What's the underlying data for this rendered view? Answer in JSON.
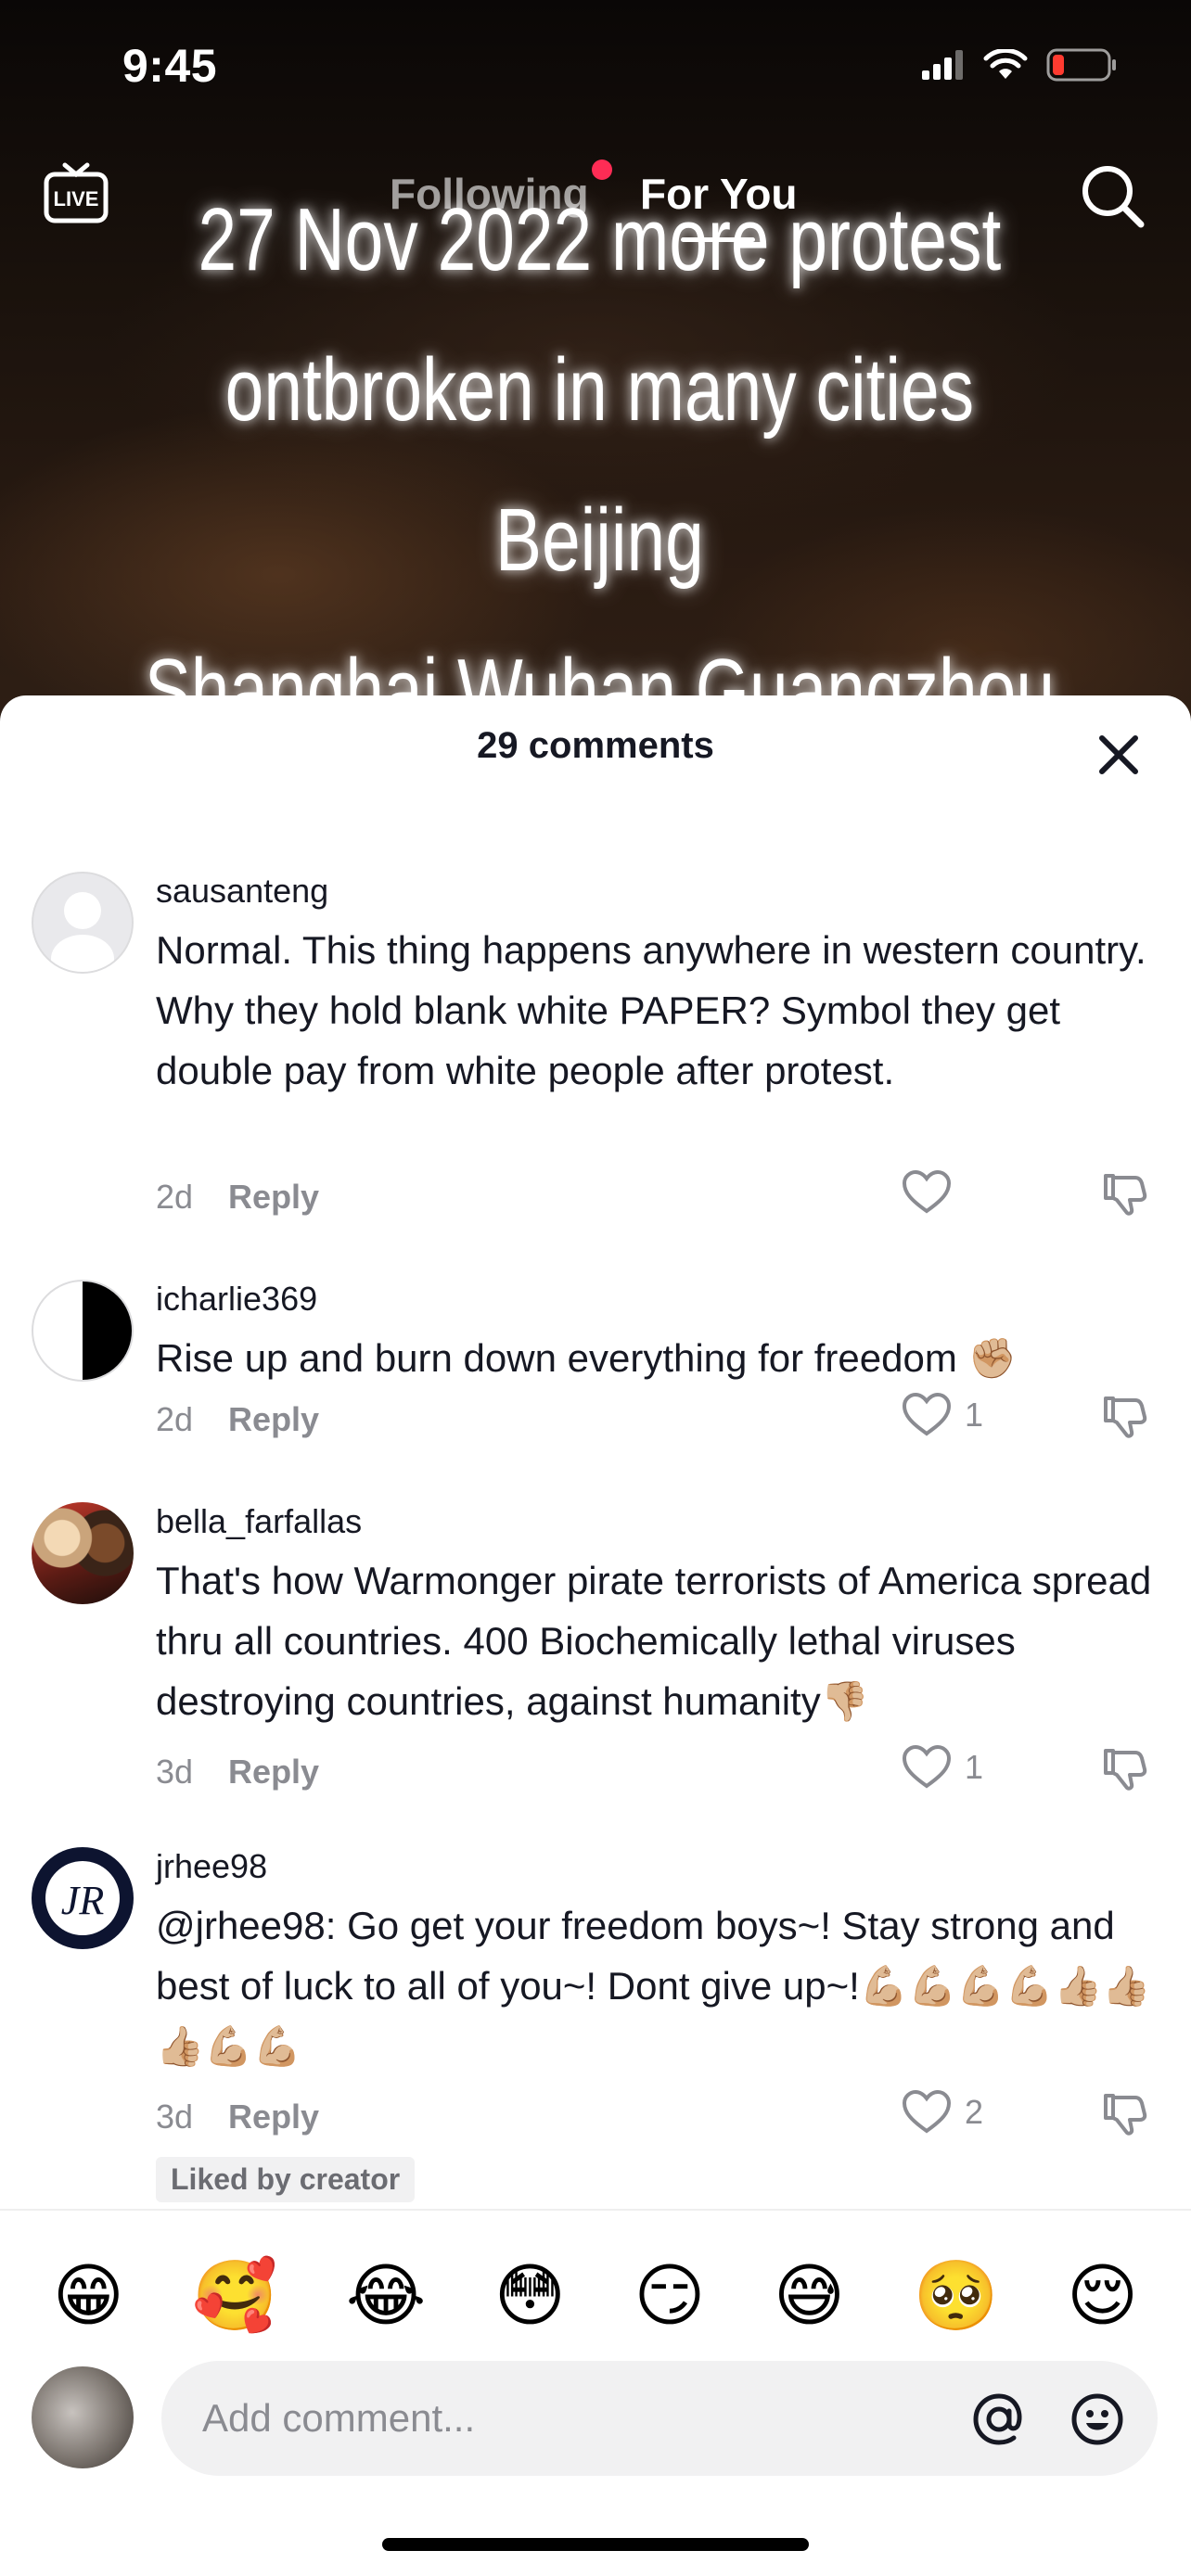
{
  "status_bar": {
    "time": "9:45"
  },
  "top_nav": {
    "live_icon": "live-tv-icon",
    "tabs": [
      {
        "label": "Following",
        "active": false,
        "has_dot": true
      },
      {
        "label": "For You",
        "active": true
      }
    ],
    "search_icon": "search-icon"
  },
  "video": {
    "overlay_text": "27 Nov 2022 more protest\nontbroken in many cities  Beijing\nShanghai Wuhan Guangzhou\nChongqing Xi'an"
  },
  "comments_sheet": {
    "title": "29 comments",
    "close_icon": "close-icon",
    "comments": [
      {
        "username": "sausanteng",
        "avatar": "default-avatar",
        "text": "Normal. This thing happens anywhere in western country. Why they hold blank white PAPER? Symbol they get double pay from white people after protest.",
        "age": "2d",
        "reply_label": "Reply",
        "like_count": ""
      },
      {
        "username": "icharlie369",
        "avatar": "half-circle-avatar",
        "text": "Rise up and burn down everything for freedom ✊🏼",
        "age": "2d",
        "reply_label": "Reply",
        "like_count": "1"
      },
      {
        "username": "bella_farfallas",
        "avatar": "photo-avatar",
        "text": "That's how Warmonger pirate terrorists of America spread thru all countries. 400 Biochemically lethal viruses destroying countries, against humanity👎🏼",
        "age": "3d",
        "reply_label": "Reply",
        "like_count": "1"
      },
      {
        "username": "jrhee98",
        "avatar": "monogram-avatar",
        "text": "@jrhee98: Go get your freedom boys~! Stay strong and best of luck to all of you~! Dont give up~!💪🏼💪🏼💪🏼💪🏼👍🏼👍🏼👍🏼💪🏼💪🏼",
        "age": "3d",
        "reply_label": "Reply",
        "like_count": "2",
        "badge": "Liked by creator"
      }
    ]
  },
  "emoji_bar": [
    "😁",
    "🥰",
    "😂",
    "😳",
    "😏",
    "😅",
    "🥺",
    "😌"
  ],
  "comment_input": {
    "placeholder": "Add comment...",
    "mention_icon": "at-icon",
    "emoji_icon": "smile-icon"
  }
}
